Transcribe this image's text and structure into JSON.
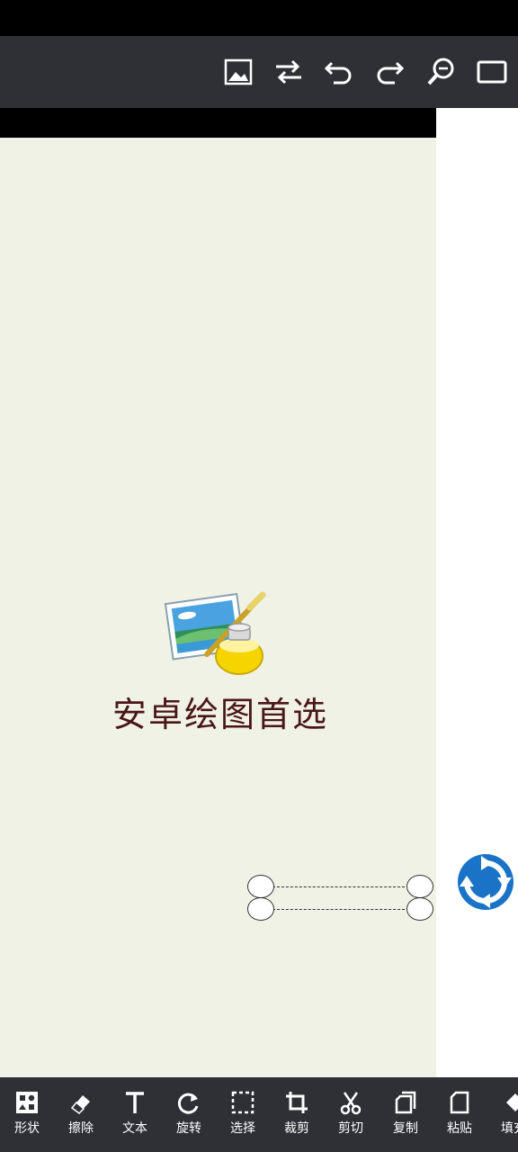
{
  "canvas": {
    "logo_text": "安卓绘图首选",
    "background_color": "#f0f2e6"
  },
  "top_toolbar": {
    "icons": [
      "image-icon",
      "swap-icon",
      "undo-icon",
      "redo-icon",
      "zoom-icon",
      "fullscreen-icon"
    ]
  },
  "bottom_toolbar": {
    "shape": "形状",
    "erase": "擦除",
    "text": "文本",
    "rotate": "旋转",
    "select": "选择",
    "crop": "裁剪",
    "cut": "剪切",
    "copy": "复制",
    "paste": "粘贴",
    "fill": "填充"
  },
  "colors": {
    "toolbar": "#2e3035",
    "accent_blue": "#1a73c6"
  }
}
